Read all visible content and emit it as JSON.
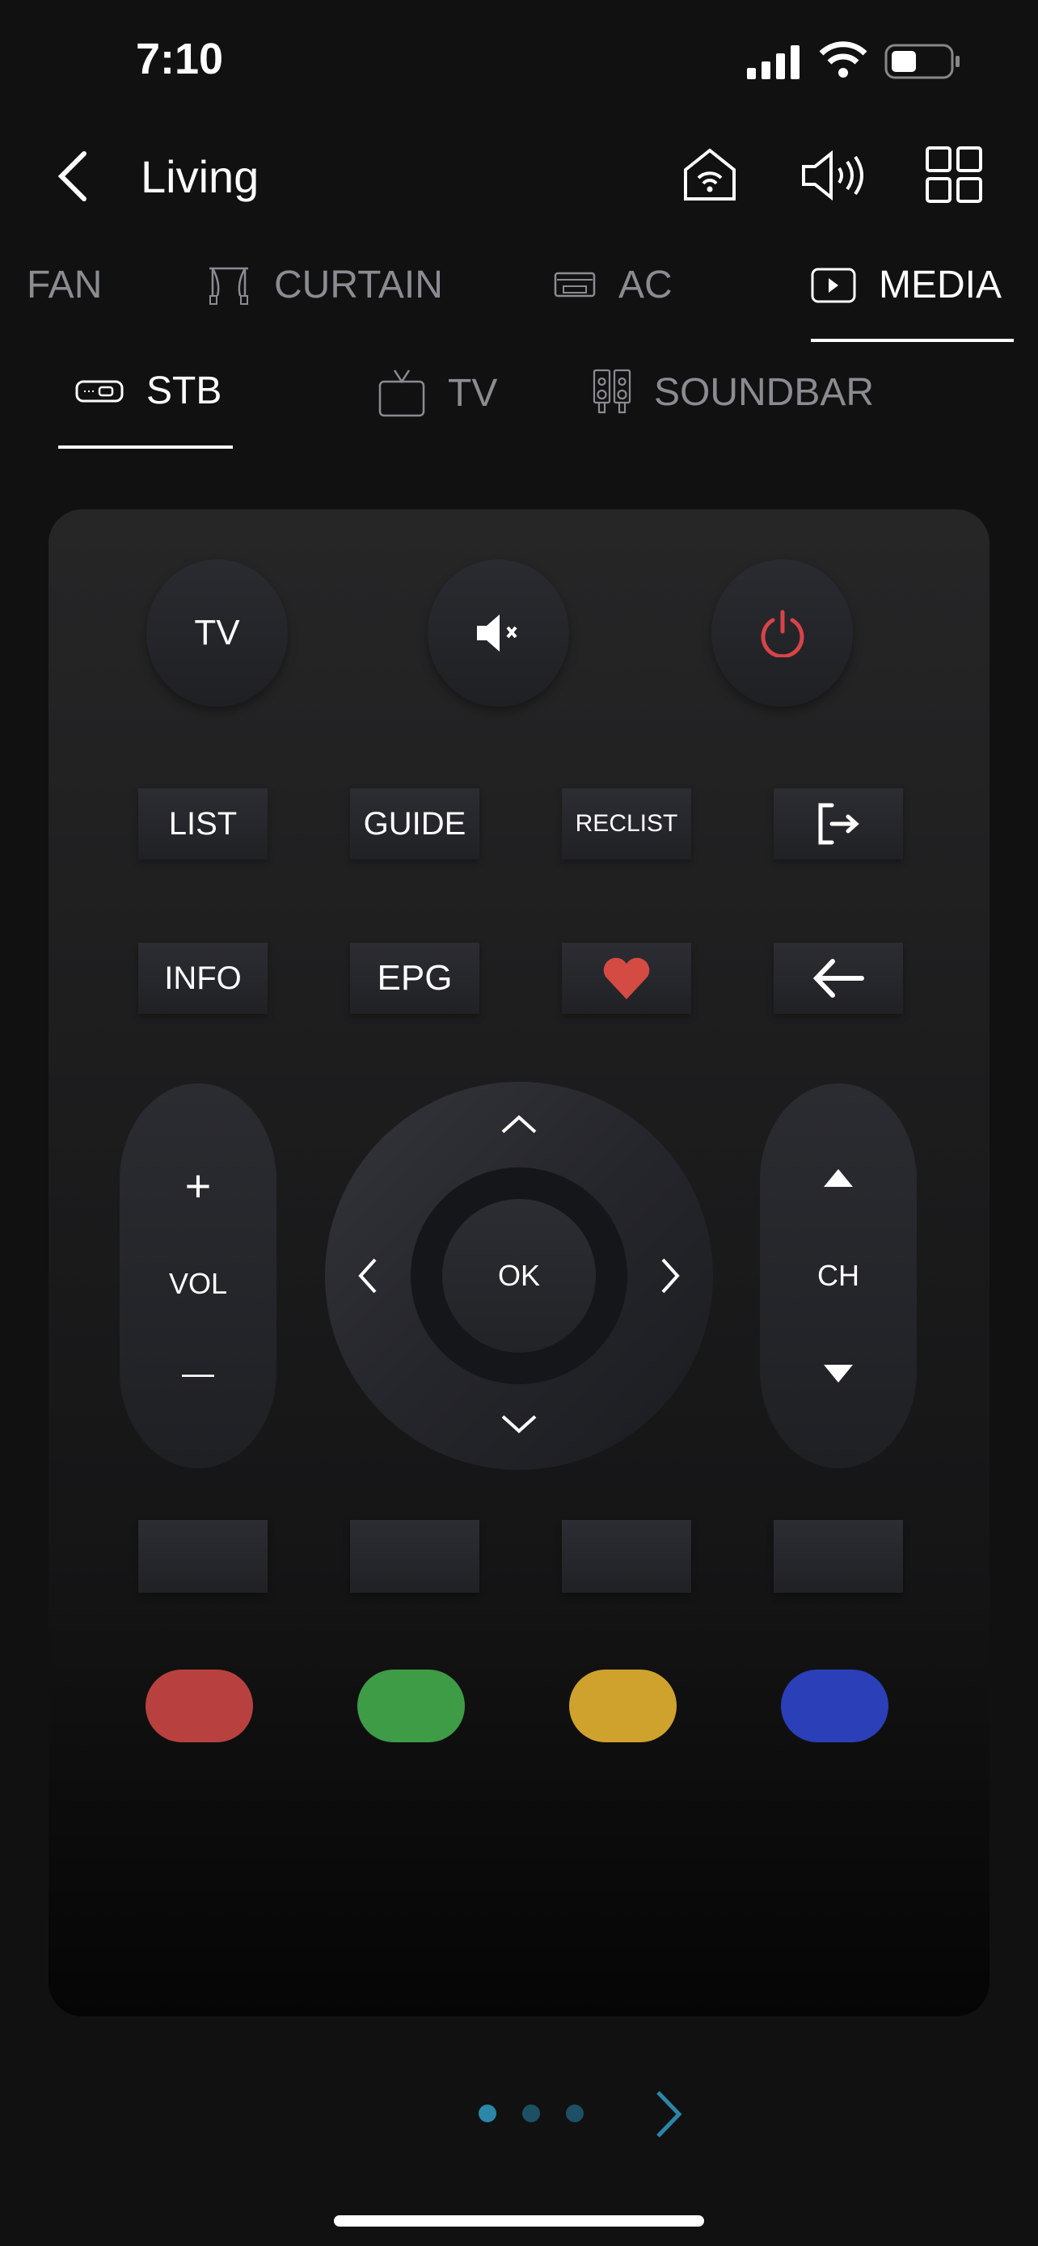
{
  "status": {
    "time": "7:10",
    "battery_level": 0.35
  },
  "header": {
    "title": "Living",
    "back_icon": "chevron-left-icon",
    "icons": [
      "home-wifi-icon",
      "speaker-icon",
      "grid-icon"
    ]
  },
  "tabs": [
    {
      "label": "FAN",
      "icon": "fan-icon"
    },
    {
      "label": "CURTAIN",
      "icon": "curtain-icon"
    },
    {
      "label": "AC",
      "icon": "ac-icon"
    },
    {
      "label": "MEDIA",
      "icon": "play-icon",
      "active": true
    }
  ],
  "subtabs": [
    {
      "label": "STB",
      "icon": "set-top-box-icon",
      "active": true
    },
    {
      "label": "TV",
      "icon": "tv-icon"
    },
    {
      "label": "SOUNDBAR",
      "icon": "speakers-icon"
    }
  ],
  "remote": {
    "tv": "TV",
    "mute_icon": "mute-icon",
    "power_icon": "power-icon",
    "row1": [
      "LIST",
      "GUIDE",
      "RECLIST"
    ],
    "exit_icon": "exit-icon",
    "row2": [
      "INFO",
      "EPG"
    ],
    "favorite_icon": "heart-icon",
    "back_icon": "arrow-left-icon",
    "vol": {
      "plus": "+",
      "label": "VOL",
      "minus": "—"
    },
    "ok": "OK",
    "ch": {
      "label": "CH"
    },
    "colors": {
      "red": "#b8413f",
      "green": "#3e9b46",
      "yellow": "#cfa22d",
      "blue": "#2a3fb8"
    },
    "power_color": "#d9434a",
    "heart_color": "#d44b44"
  },
  "pager": {
    "pages": 3,
    "current": 1,
    "accent": "#2b86a8"
  }
}
